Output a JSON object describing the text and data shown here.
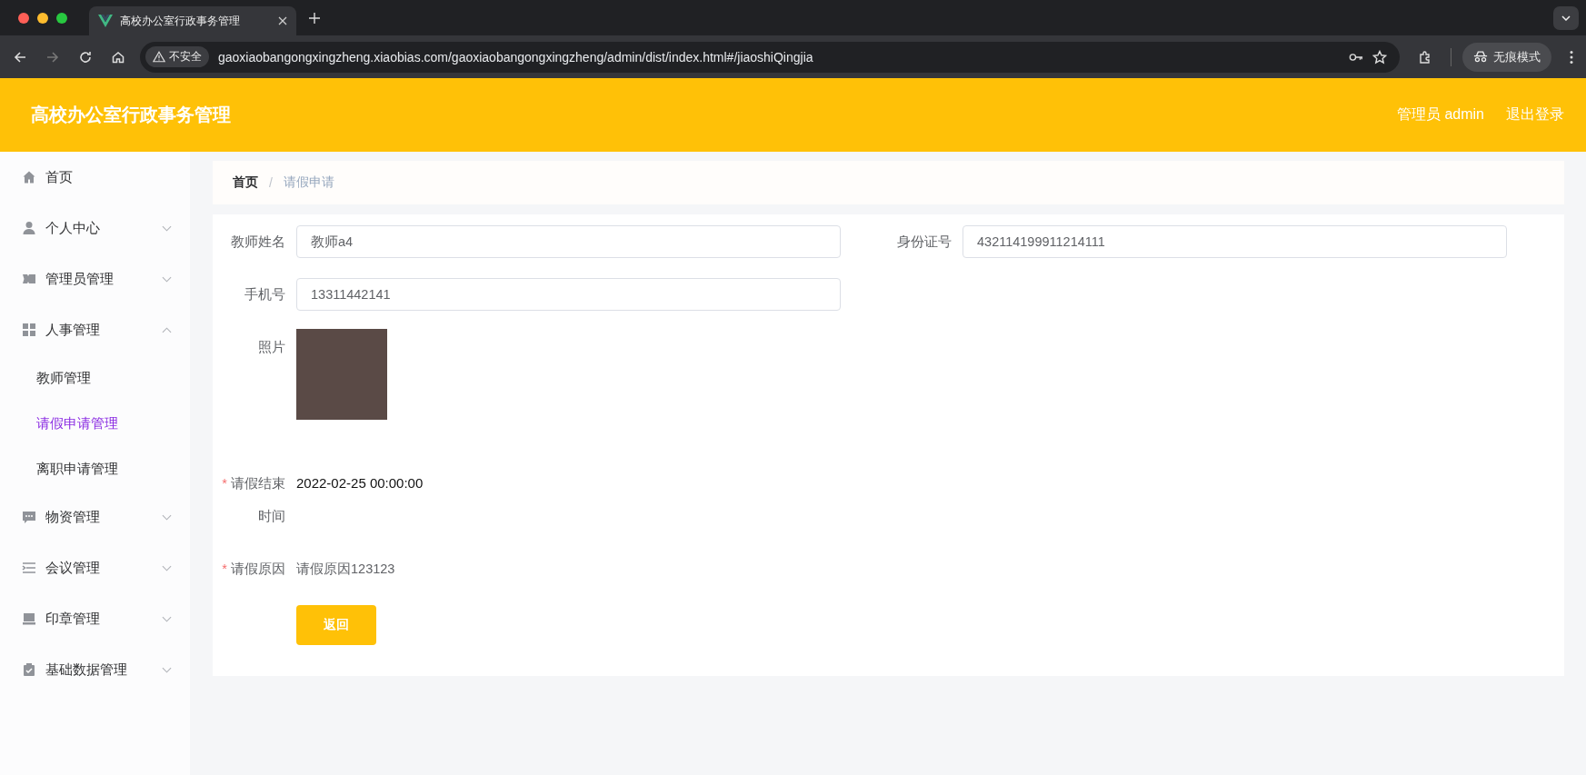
{
  "browser": {
    "tab_title": "高校办公室行政事务管理",
    "security_label": "不安全",
    "url": "gaoxiaobangongxingzheng.xiaobias.com/gaoxiaobangongxingzheng/admin/dist/index.html#/jiaoshiQingjia",
    "profile_label": "无痕模式"
  },
  "header": {
    "title": "高校办公室行政事务管理",
    "user": "管理员 admin",
    "logout": "退出登录"
  },
  "sidebar": {
    "items": [
      {
        "label": "首页"
      },
      {
        "label": "个人中心",
        "expanded": false
      },
      {
        "label": "管理员管理",
        "expanded": false
      },
      {
        "label": "人事管理",
        "expanded": true,
        "children": [
          {
            "label": "教师管理",
            "selected": false
          },
          {
            "label": "请假申请管理",
            "selected": true
          },
          {
            "label": "离职申请管理",
            "selected": false
          }
        ]
      },
      {
        "label": "物资管理",
        "expanded": false
      },
      {
        "label": "会议管理",
        "expanded": false
      },
      {
        "label": "印章管理",
        "expanded": false
      },
      {
        "label": "基础数据管理",
        "expanded": false
      }
    ]
  },
  "breadcrumb": [
    {
      "label": "首页",
      "current": false
    },
    {
      "label": "请假申请",
      "current": true
    }
  ],
  "breadcrumb_separator": "/",
  "form": {
    "rows": [
      [
        {
          "kind": "input",
          "label": "教师姓名",
          "value": "教师a4"
        },
        {
          "kind": "input",
          "label": "身份证号",
          "value": "432114199911214111"
        }
      ],
      [
        {
          "kind": "input",
          "label": "手机号",
          "value": "13311442141"
        }
      ],
      [
        {
          "kind": "photo",
          "label": "照片"
        }
      ],
      [
        {
          "kind": "text",
          "label": "请假结束时间",
          "mark": "*",
          "value": "2022-02-25 00:00:00",
          "dark": true
        }
      ],
      [
        {
          "kind": "text",
          "label": "请假原因",
          "mark": "*",
          "value": "请假原因123123",
          "dark": false
        }
      ]
    ],
    "button": "返回"
  }
}
